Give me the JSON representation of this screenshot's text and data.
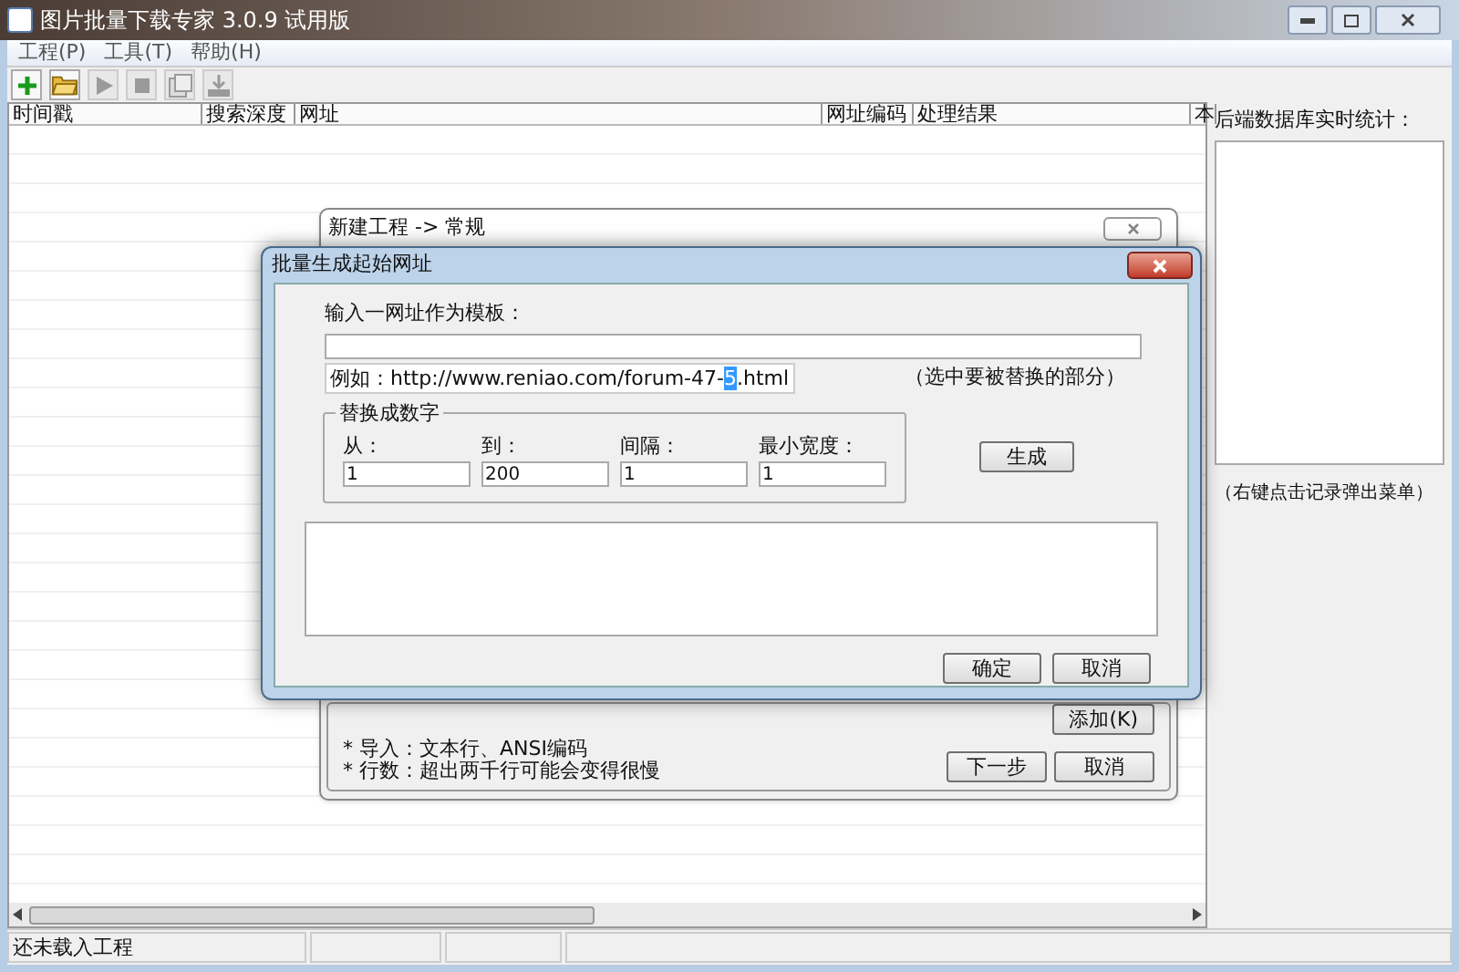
{
  "window": {
    "title": "图片批量下载专家 3.0.9 试用版"
  },
  "menu": [
    "工程(P)",
    "工具(T)",
    "帮助(H)"
  ],
  "toolbar": [
    {
      "kind": "new",
      "disabled": false
    },
    {
      "kind": "open",
      "disabled": false
    },
    {
      "kind": "start",
      "disabled": true
    },
    {
      "kind": "stop",
      "disabled": true
    },
    {
      "kind": "properties",
      "disabled": true
    },
    {
      "kind": "export",
      "disabled": true
    }
  ],
  "table": {
    "columns": [
      "时间戳",
      "搜索深度",
      "网址",
      "网址编码",
      "处理结果",
      "本"
    ]
  },
  "side_panel": {
    "label": "后端数据库实时统计：",
    "hint": "（右键点击记录弹出菜单）"
  },
  "status_bar": {
    "text": "还未载入工程"
  },
  "back_dialog": {
    "title": "新建工程 -> 常规",
    "add_button": "添加(K)",
    "notes": [
      "* 导入：文本行、ANSI编码",
      "* 行数：超出两千行可能会变得很慢"
    ],
    "buttons": [
      "下一步",
      "取消"
    ]
  },
  "dialog": {
    "title": "批量生成起始网址",
    "template_label": "输入一网址作为模板：",
    "example": {
      "before": "例如：http://www.reniao.com/forum-47-",
      "selected": "5",
      "after": ".html"
    },
    "example_hint": "（选中要被替换的部分）",
    "group_title": "替换成数字",
    "fields": [
      {
        "label": "从：",
        "value": "1"
      },
      {
        "label": "到：",
        "value": "200"
      },
      {
        "label": "间隔：",
        "value": "1"
      },
      {
        "label": "最小宽度：",
        "value": "1"
      }
    ],
    "generate_button": "生成",
    "buttons": [
      "确定",
      "取消"
    ]
  }
}
